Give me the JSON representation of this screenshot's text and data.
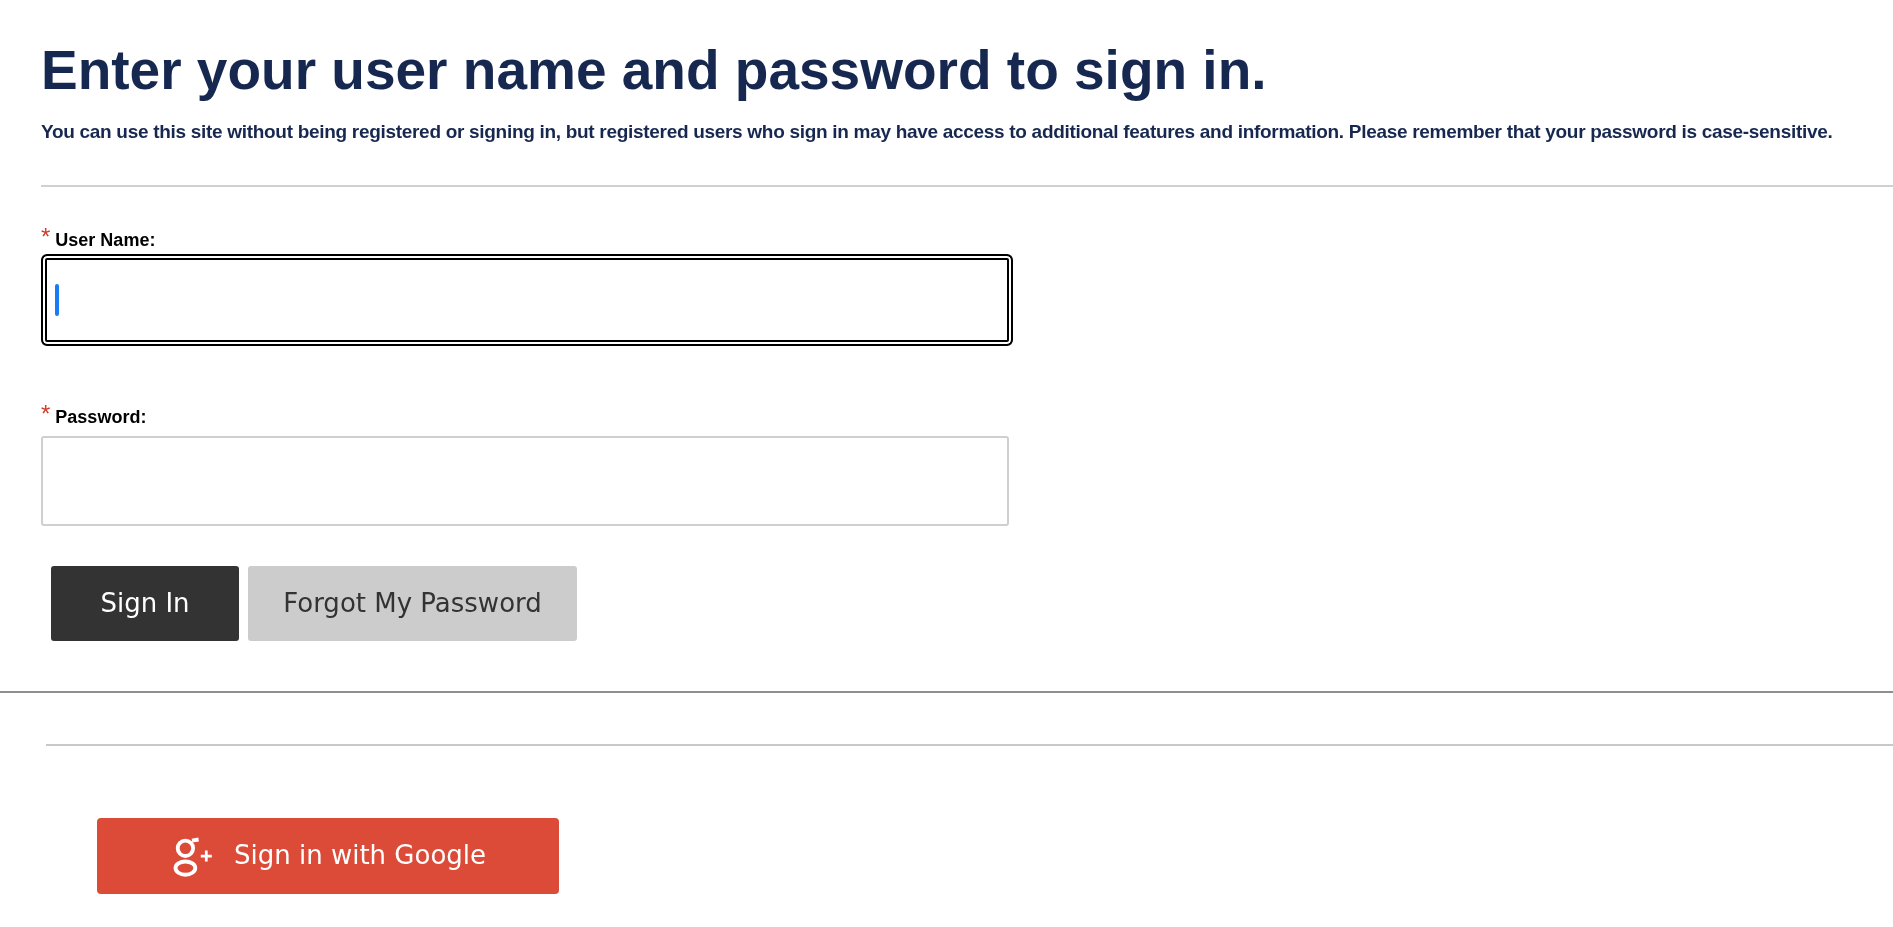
{
  "title": "Enter your user name and password to sign in.",
  "intro": "You can use this site without being registered or signing in, but registered users who sign in may have access to additional features and information. Please remember that your password is case-sensitive.",
  "fields": [
    {
      "label": "User Name:",
      "required_mark": "*",
      "focused": true
    },
    {
      "label": "Password:",
      "required_mark": "*",
      "focused": false
    }
  ],
  "buttons": [
    {
      "kind": "primary",
      "label": "Sign In"
    },
    {
      "kind": "secondary",
      "label": "Forgot My Password"
    }
  ],
  "social_button": {
    "label": "Sign in with Google"
  }
}
